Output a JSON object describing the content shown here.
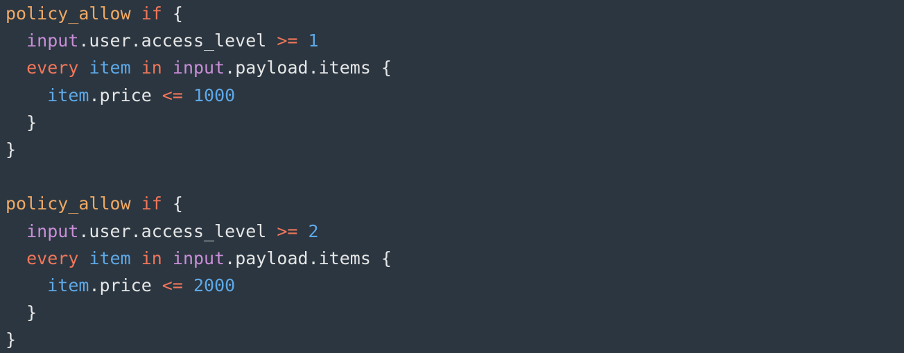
{
  "code": {
    "lines": [
      [
        {
          "c": "func",
          "t": "policy_allow"
        },
        {
          "c": "plain",
          "t": " "
        },
        {
          "c": "kw",
          "t": "if"
        },
        {
          "c": "plain",
          "t": " {"
        }
      ],
      [
        {
          "c": "plain",
          "t": "  "
        },
        {
          "c": "input",
          "t": "input"
        },
        {
          "c": "plain",
          "t": ".user.access_level "
        },
        {
          "c": "op",
          "t": ">="
        },
        {
          "c": "plain",
          "t": " "
        },
        {
          "c": "num",
          "t": "1"
        }
      ],
      [
        {
          "c": "plain",
          "t": "  "
        },
        {
          "c": "kw",
          "t": "every"
        },
        {
          "c": "plain",
          "t": " "
        },
        {
          "c": "var",
          "t": "item"
        },
        {
          "c": "plain",
          "t": " "
        },
        {
          "c": "kw",
          "t": "in"
        },
        {
          "c": "plain",
          "t": " "
        },
        {
          "c": "input",
          "t": "input"
        },
        {
          "c": "plain",
          "t": ".payload.items {"
        }
      ],
      [
        {
          "c": "plain",
          "t": "    "
        },
        {
          "c": "var",
          "t": "item"
        },
        {
          "c": "plain",
          "t": ".price "
        },
        {
          "c": "op",
          "t": "<="
        },
        {
          "c": "plain",
          "t": " "
        },
        {
          "c": "num",
          "t": "1000"
        }
      ],
      [
        {
          "c": "plain",
          "t": "  }"
        }
      ],
      [
        {
          "c": "plain",
          "t": "}"
        }
      ],
      [],
      [
        {
          "c": "func",
          "t": "policy_allow"
        },
        {
          "c": "plain",
          "t": " "
        },
        {
          "c": "kw",
          "t": "if"
        },
        {
          "c": "plain",
          "t": " {"
        }
      ],
      [
        {
          "c": "plain",
          "t": "  "
        },
        {
          "c": "input",
          "t": "input"
        },
        {
          "c": "plain",
          "t": ".user.access_level "
        },
        {
          "c": "op",
          "t": ">="
        },
        {
          "c": "plain",
          "t": " "
        },
        {
          "c": "num",
          "t": "2"
        }
      ],
      [
        {
          "c": "plain",
          "t": "  "
        },
        {
          "c": "kw",
          "t": "every"
        },
        {
          "c": "plain",
          "t": " "
        },
        {
          "c": "var",
          "t": "item"
        },
        {
          "c": "plain",
          "t": " "
        },
        {
          "c": "kw",
          "t": "in"
        },
        {
          "c": "plain",
          "t": " "
        },
        {
          "c": "input",
          "t": "input"
        },
        {
          "c": "plain",
          "t": ".payload.items {"
        }
      ],
      [
        {
          "c": "plain",
          "t": "    "
        },
        {
          "c": "var",
          "t": "item"
        },
        {
          "c": "plain",
          "t": ".price "
        },
        {
          "c": "op",
          "t": "<="
        },
        {
          "c": "plain",
          "t": " "
        },
        {
          "c": "num",
          "t": "2000"
        }
      ],
      [
        {
          "c": "plain",
          "t": "  }"
        }
      ],
      [
        {
          "c": "plain",
          "t": "}"
        }
      ]
    ]
  },
  "colors": {
    "background": "#2b3640",
    "function_name": "#f0a964",
    "keyword": "#f0765a",
    "operator": "#f0765a",
    "input_ref": "#c98ed8",
    "variable": "#5fa8e6",
    "number": "#5fa8e6",
    "plain_text": "#e6e6e6"
  }
}
